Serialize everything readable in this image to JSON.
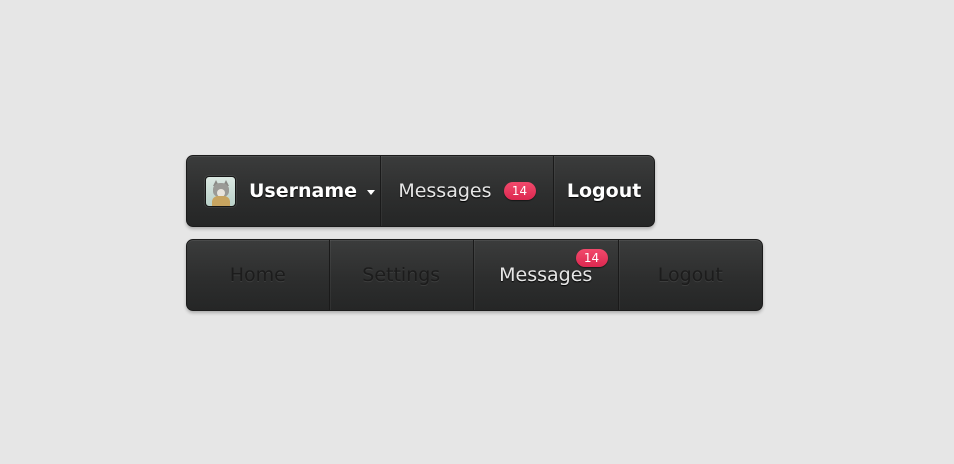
{
  "nav_top": {
    "username": "Username",
    "messages_label": "Messages",
    "messages_count": "14",
    "logout_label": "Logout"
  },
  "nav_bottom": {
    "items": [
      {
        "label": "Home",
        "active": false
      },
      {
        "label": "Settings",
        "active": false
      },
      {
        "label": "Messages",
        "active": true,
        "badge": "14"
      },
      {
        "label": "Logout",
        "active": false
      }
    ]
  },
  "colors": {
    "background": "#e6e6e6",
    "bar": "#2d2e2e",
    "badge": "#e8355c",
    "active_text": "#ffffff",
    "inactive_text": "#1c1c1c"
  },
  "icons": {
    "avatar": "cat-avatar-icon",
    "dropdown": "caret-down-icon"
  }
}
